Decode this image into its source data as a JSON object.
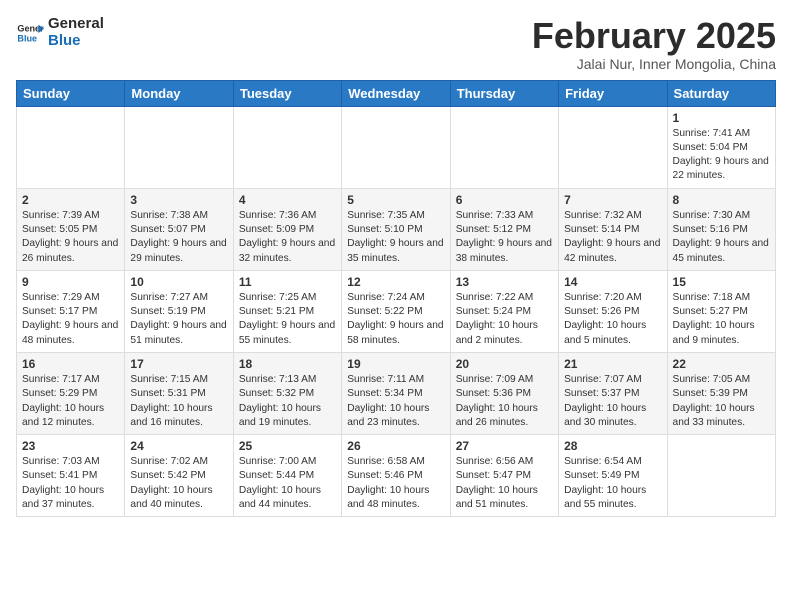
{
  "header": {
    "logo_line1": "General",
    "logo_line2": "Blue",
    "month_title": "February 2025",
    "location": "Jalai Nur, Inner Mongolia, China"
  },
  "weekdays": [
    "Sunday",
    "Monday",
    "Tuesday",
    "Wednesday",
    "Thursday",
    "Friday",
    "Saturday"
  ],
  "weeks": [
    [
      {
        "day": "",
        "info": ""
      },
      {
        "day": "",
        "info": ""
      },
      {
        "day": "",
        "info": ""
      },
      {
        "day": "",
        "info": ""
      },
      {
        "day": "",
        "info": ""
      },
      {
        "day": "",
        "info": ""
      },
      {
        "day": "1",
        "info": "Sunrise: 7:41 AM\nSunset: 5:04 PM\nDaylight: 9 hours and 22 minutes."
      }
    ],
    [
      {
        "day": "2",
        "info": "Sunrise: 7:39 AM\nSunset: 5:05 PM\nDaylight: 9 hours and 26 minutes."
      },
      {
        "day": "3",
        "info": "Sunrise: 7:38 AM\nSunset: 5:07 PM\nDaylight: 9 hours and 29 minutes."
      },
      {
        "day": "4",
        "info": "Sunrise: 7:36 AM\nSunset: 5:09 PM\nDaylight: 9 hours and 32 minutes."
      },
      {
        "day": "5",
        "info": "Sunrise: 7:35 AM\nSunset: 5:10 PM\nDaylight: 9 hours and 35 minutes."
      },
      {
        "day": "6",
        "info": "Sunrise: 7:33 AM\nSunset: 5:12 PM\nDaylight: 9 hours and 38 minutes."
      },
      {
        "day": "7",
        "info": "Sunrise: 7:32 AM\nSunset: 5:14 PM\nDaylight: 9 hours and 42 minutes."
      },
      {
        "day": "8",
        "info": "Sunrise: 7:30 AM\nSunset: 5:16 PM\nDaylight: 9 hours and 45 minutes."
      }
    ],
    [
      {
        "day": "9",
        "info": "Sunrise: 7:29 AM\nSunset: 5:17 PM\nDaylight: 9 hours and 48 minutes."
      },
      {
        "day": "10",
        "info": "Sunrise: 7:27 AM\nSunset: 5:19 PM\nDaylight: 9 hours and 51 minutes."
      },
      {
        "day": "11",
        "info": "Sunrise: 7:25 AM\nSunset: 5:21 PM\nDaylight: 9 hours and 55 minutes."
      },
      {
        "day": "12",
        "info": "Sunrise: 7:24 AM\nSunset: 5:22 PM\nDaylight: 9 hours and 58 minutes."
      },
      {
        "day": "13",
        "info": "Sunrise: 7:22 AM\nSunset: 5:24 PM\nDaylight: 10 hours and 2 minutes."
      },
      {
        "day": "14",
        "info": "Sunrise: 7:20 AM\nSunset: 5:26 PM\nDaylight: 10 hours and 5 minutes."
      },
      {
        "day": "15",
        "info": "Sunrise: 7:18 AM\nSunset: 5:27 PM\nDaylight: 10 hours and 9 minutes."
      }
    ],
    [
      {
        "day": "16",
        "info": "Sunrise: 7:17 AM\nSunset: 5:29 PM\nDaylight: 10 hours and 12 minutes."
      },
      {
        "day": "17",
        "info": "Sunrise: 7:15 AM\nSunset: 5:31 PM\nDaylight: 10 hours and 16 minutes."
      },
      {
        "day": "18",
        "info": "Sunrise: 7:13 AM\nSunset: 5:32 PM\nDaylight: 10 hours and 19 minutes."
      },
      {
        "day": "19",
        "info": "Sunrise: 7:11 AM\nSunset: 5:34 PM\nDaylight: 10 hours and 23 minutes."
      },
      {
        "day": "20",
        "info": "Sunrise: 7:09 AM\nSunset: 5:36 PM\nDaylight: 10 hours and 26 minutes."
      },
      {
        "day": "21",
        "info": "Sunrise: 7:07 AM\nSunset: 5:37 PM\nDaylight: 10 hours and 30 minutes."
      },
      {
        "day": "22",
        "info": "Sunrise: 7:05 AM\nSunset: 5:39 PM\nDaylight: 10 hours and 33 minutes."
      }
    ],
    [
      {
        "day": "23",
        "info": "Sunrise: 7:03 AM\nSunset: 5:41 PM\nDaylight: 10 hours and 37 minutes."
      },
      {
        "day": "24",
        "info": "Sunrise: 7:02 AM\nSunset: 5:42 PM\nDaylight: 10 hours and 40 minutes."
      },
      {
        "day": "25",
        "info": "Sunrise: 7:00 AM\nSunset: 5:44 PM\nDaylight: 10 hours and 44 minutes."
      },
      {
        "day": "26",
        "info": "Sunrise: 6:58 AM\nSunset: 5:46 PM\nDaylight: 10 hours and 48 minutes."
      },
      {
        "day": "27",
        "info": "Sunrise: 6:56 AM\nSunset: 5:47 PM\nDaylight: 10 hours and 51 minutes."
      },
      {
        "day": "28",
        "info": "Sunrise: 6:54 AM\nSunset: 5:49 PM\nDaylight: 10 hours and 55 minutes."
      },
      {
        "day": "",
        "info": ""
      }
    ]
  ]
}
